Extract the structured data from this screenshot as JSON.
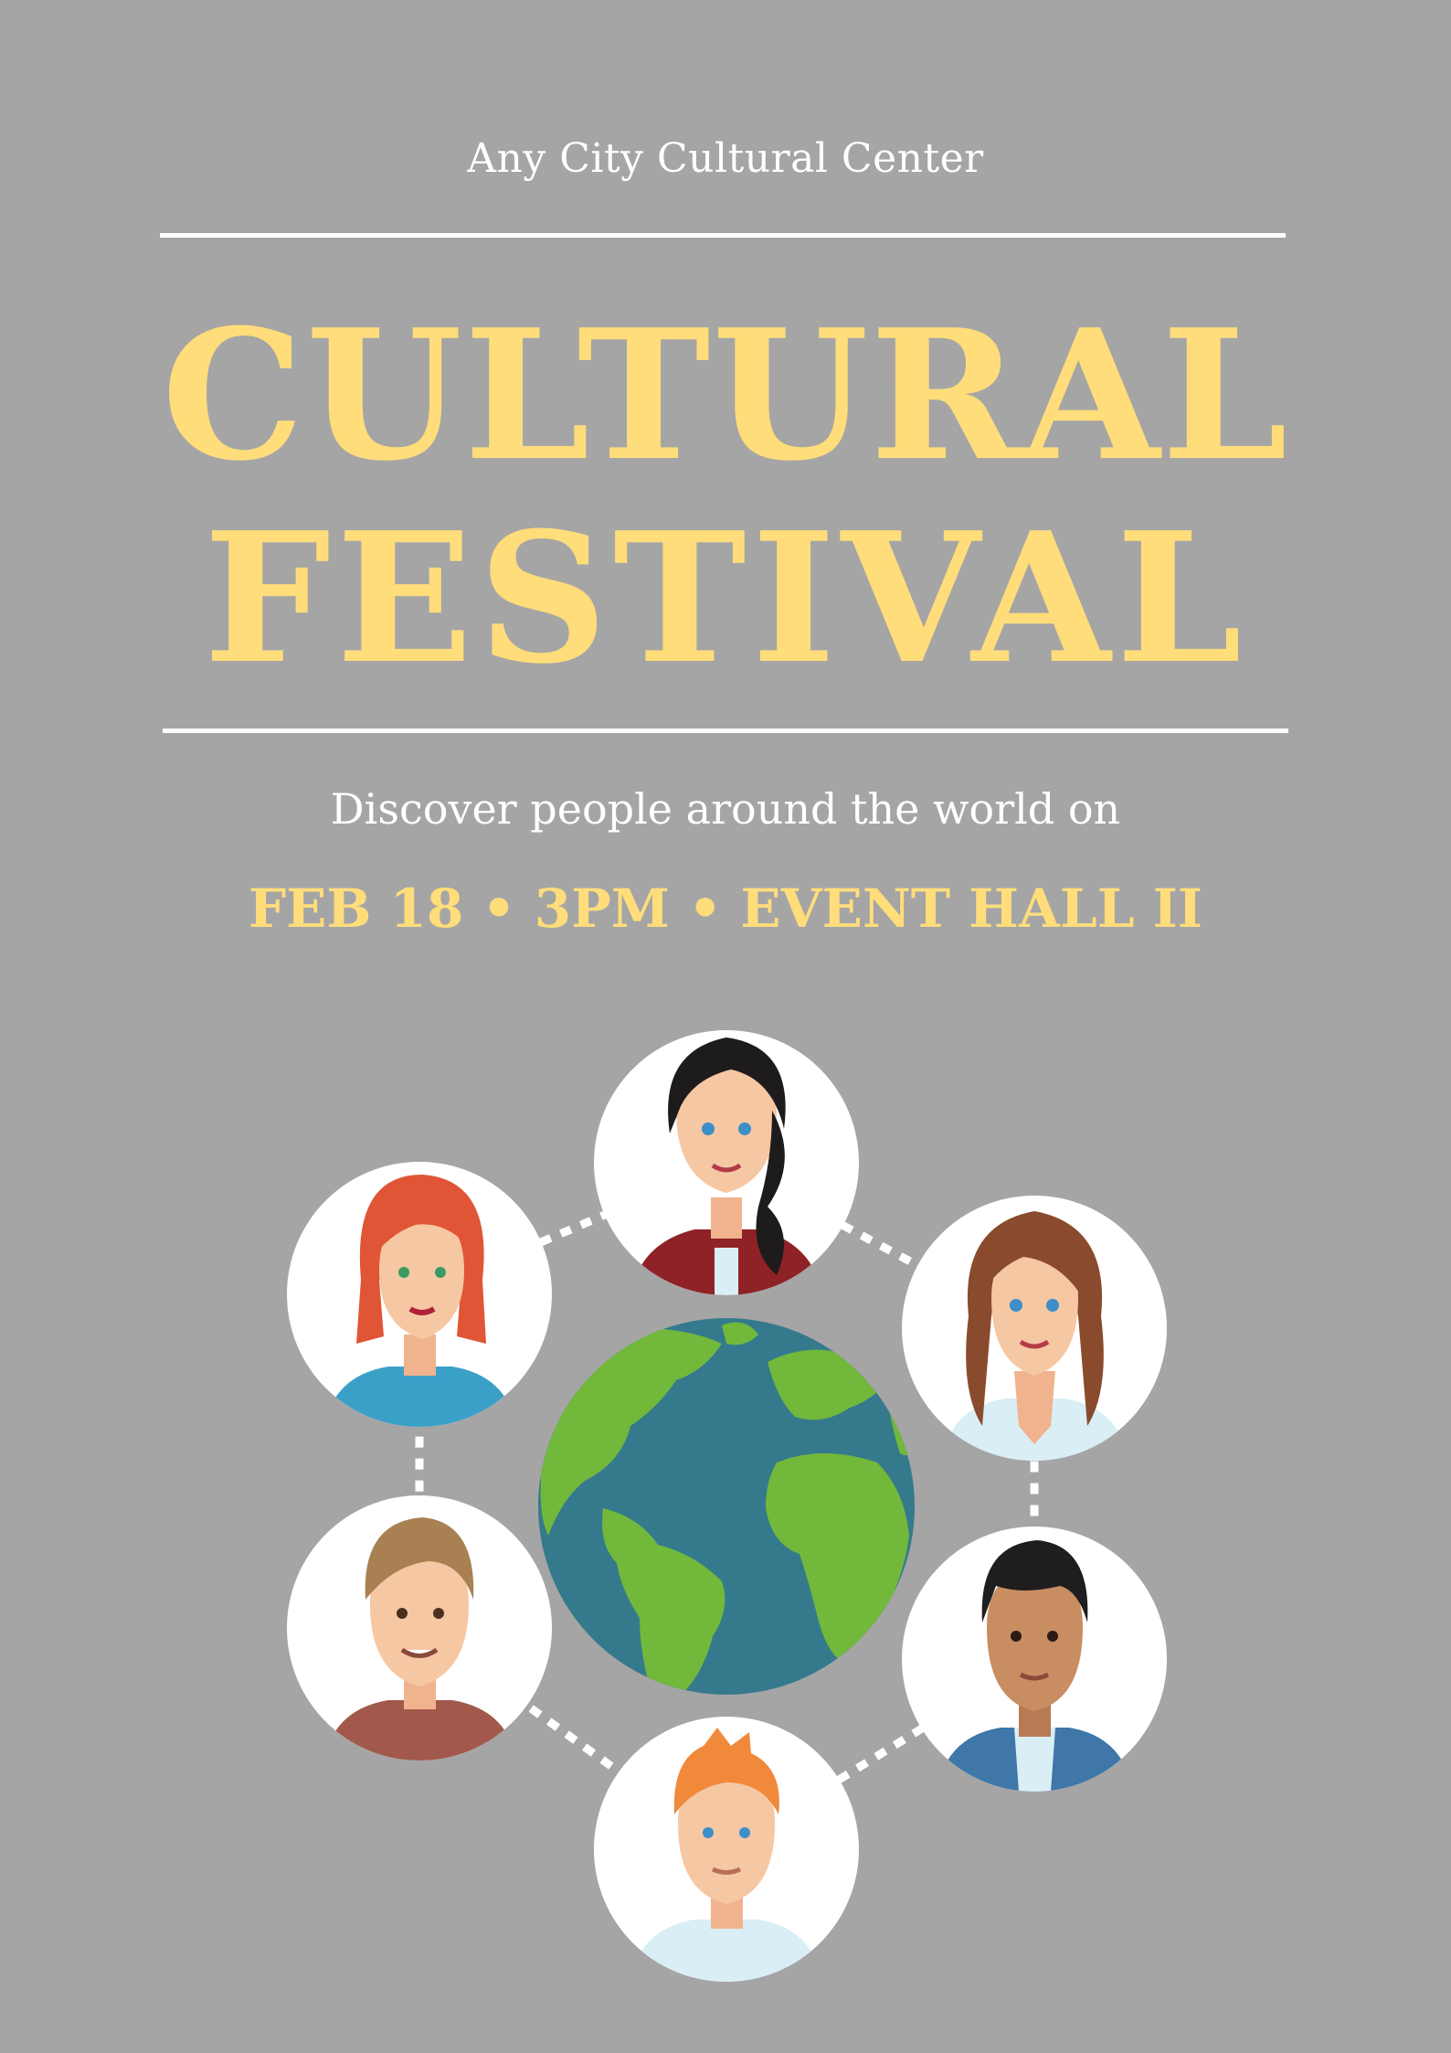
{
  "poster": {
    "organizer": "Any City Cultural Center",
    "title_line_1": "CULTURAL",
    "title_line_2": "FESTIVAL",
    "subtitle": "Discover people around the world on",
    "event_details": "FEB 18 • 3PM • EVENT HALL II"
  },
  "colors": {
    "background": "#a5a5a5",
    "accent": "#ffdd7b",
    "text": "#ffffff",
    "globe_ocean": "#357a8c",
    "globe_land": "#72b83b"
  },
  "illustration": {
    "globe": "globe-icon",
    "avatars": [
      "avatar-woman-dark-hair",
      "avatar-woman-brown-hair",
      "avatar-man-dark-hair",
      "avatar-man-orange-hair",
      "avatar-man-light-brown-hair",
      "avatar-woman-red-hair"
    ]
  }
}
